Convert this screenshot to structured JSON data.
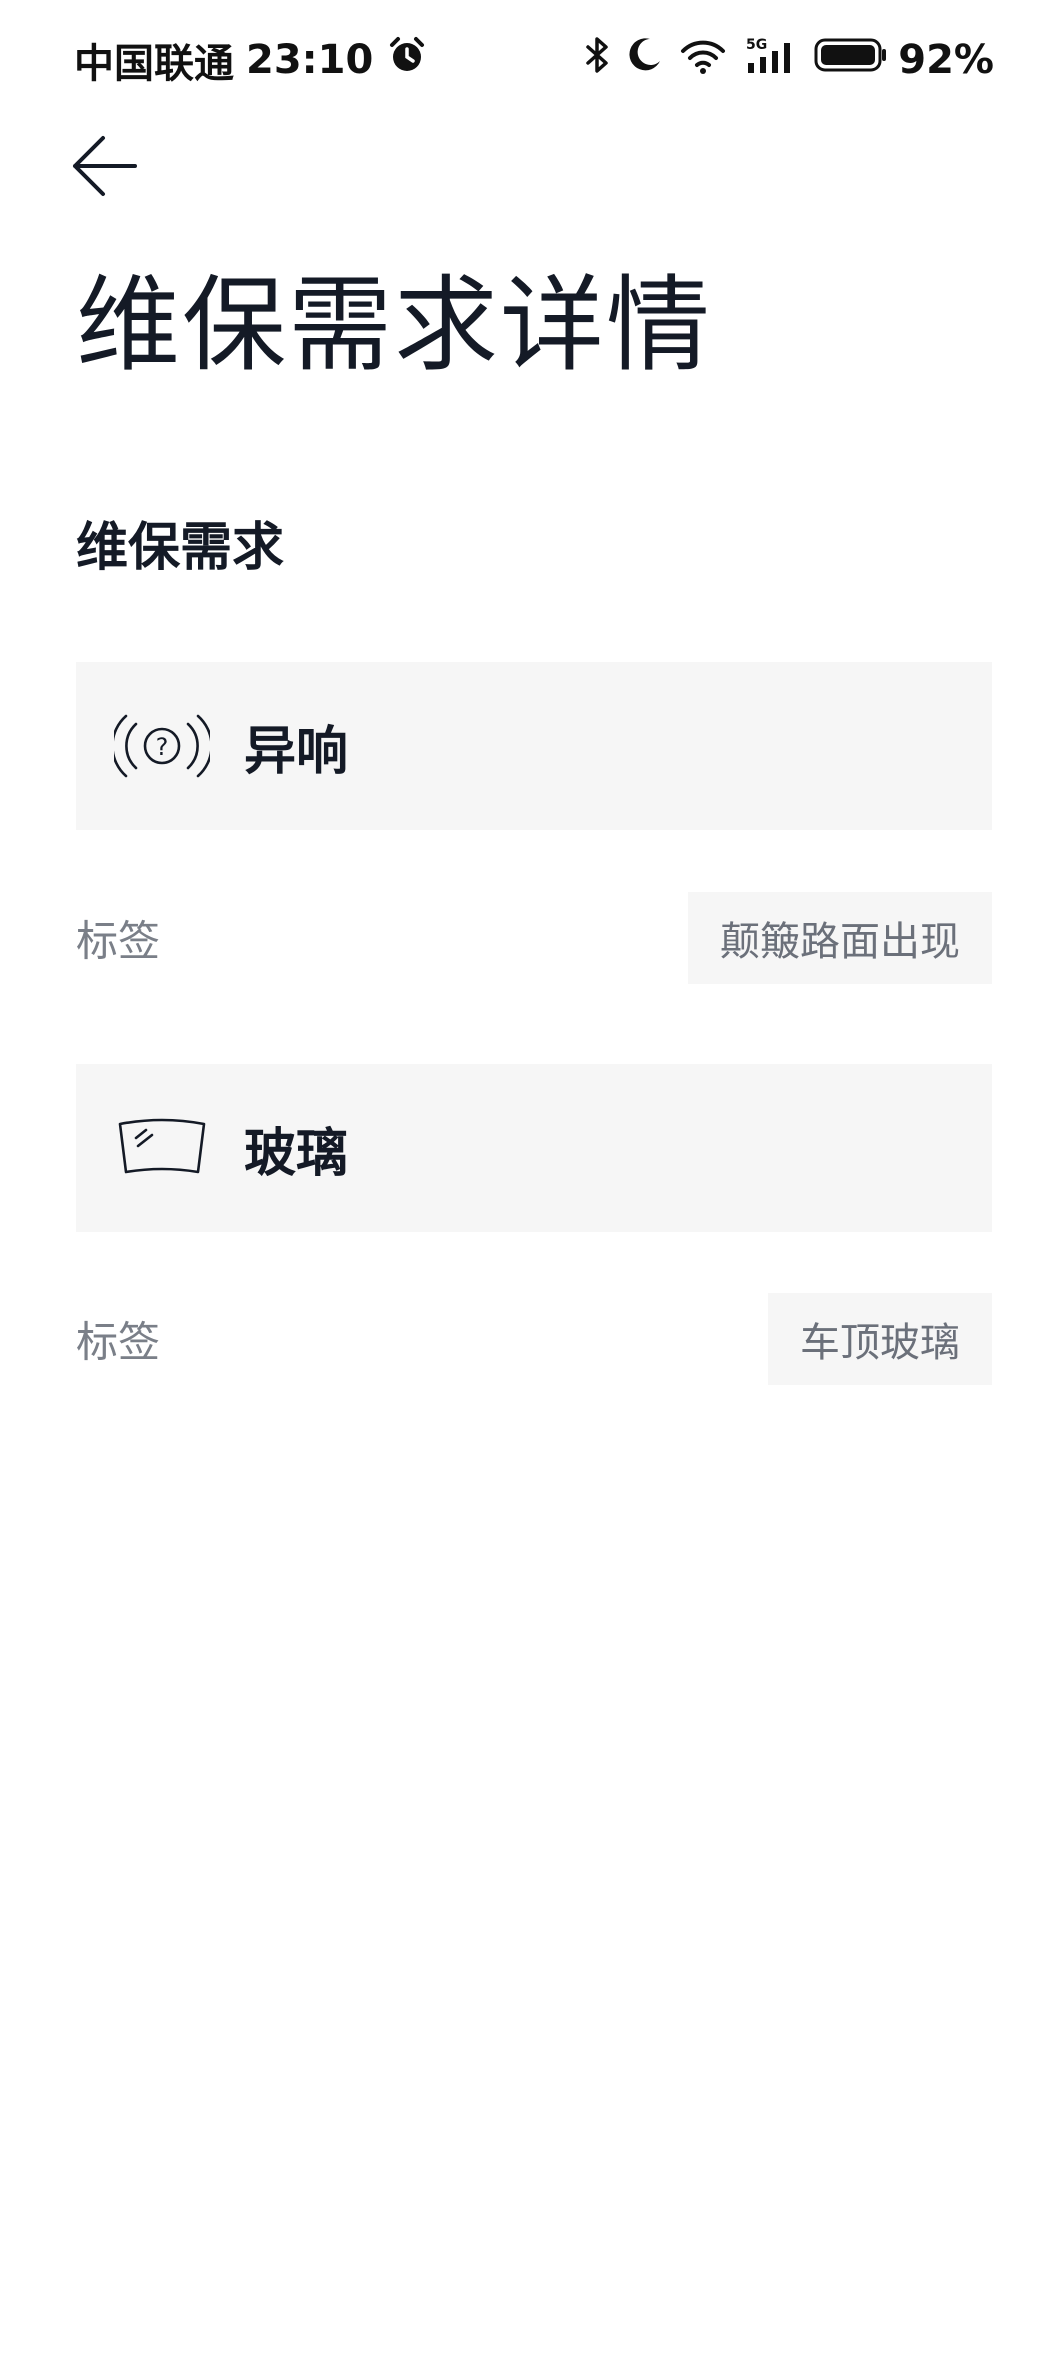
{
  "status_bar": {
    "carrier": "中国联通",
    "time": "23:10",
    "battery": "92%",
    "icons": [
      "alarm-icon",
      "bluetooth-icon",
      "moon-icon",
      "wifi-icon",
      "signal-5g-icon",
      "battery-icon"
    ]
  },
  "header": {
    "back_icon": "arrow-left-icon",
    "title": "维保需求详情"
  },
  "section": {
    "title": "维保需求"
  },
  "requests": [
    {
      "icon": "sound-question-icon",
      "name": "异响",
      "tag_label": "标签",
      "tag_value": "颠簸路面出现"
    },
    {
      "icon": "windshield-icon",
      "name": "玻璃",
      "tag_label": "标签",
      "tag_value": "车顶玻璃"
    }
  ],
  "colors": {
    "text_primary": "#141a26",
    "text_secondary": "#7a7f88",
    "card_background": "#f6f6f6",
    "page_background": "#ffffff"
  }
}
